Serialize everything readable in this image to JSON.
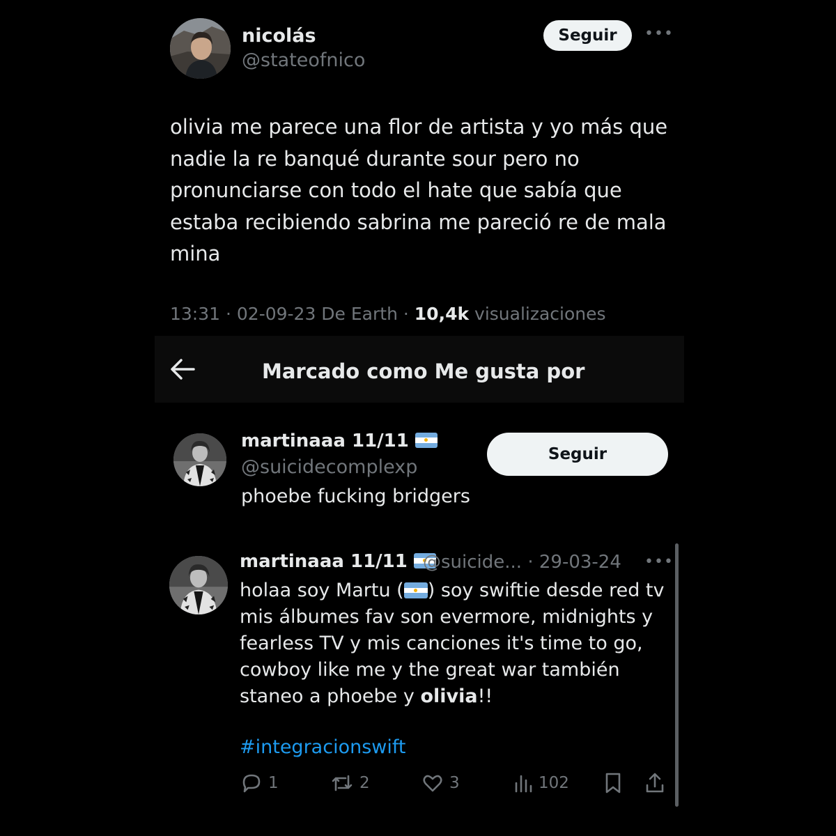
{
  "tweet": {
    "author_name": "nicolás",
    "author_handle": "@stateofnico",
    "follow_label": "Seguir",
    "more_icon": "more-horizontal-icon",
    "text": "olivia me parece una flor de artista y yo más que nadie la re banqué durante sour pero no pronunciarse con todo el hate que sabía que estaba recibiendo sabrina me pareció re de mala mina",
    "meta_prefix": "13:31 · 02-09-23 De Earth · ",
    "views_count": "10,4k",
    "views_label": " visualizaciones"
  },
  "liked_by": {
    "back_icon": "arrow-left-icon",
    "title": "Marcado como Me gusta por"
  },
  "user": {
    "name": "martinaaa 11/11",
    "handle": "@suicidecomplexp",
    "follow_label": "Seguir",
    "bio": "phoebe fucking bridgers"
  },
  "pinned_tweet": {
    "name": "martinaaa 11/11",
    "handle": "@suicide...",
    "date": "· 29-03-24",
    "text_part1": "holaa soy Martu (",
    "text_part2": ") soy swiftie desde red tv mis álbumes fav son evermore, midnights y fearless TV y mis canciones it's time to go, cowboy like me y the great war también staneo a phoebe y ",
    "text_bold": "olivia",
    "text_part3": "!!",
    "hashtag": "#integracionswift",
    "replies": "1",
    "retweets": "2",
    "likes": "3",
    "views": "102"
  },
  "colors": {
    "background": "#000000",
    "text": "#e7e9ea",
    "muted": "#71767b",
    "link": "#1d9bf0",
    "button_bg": "#eff3f4",
    "flag_blue": "#74acdf",
    "flag_sun": "#f6b40e"
  }
}
